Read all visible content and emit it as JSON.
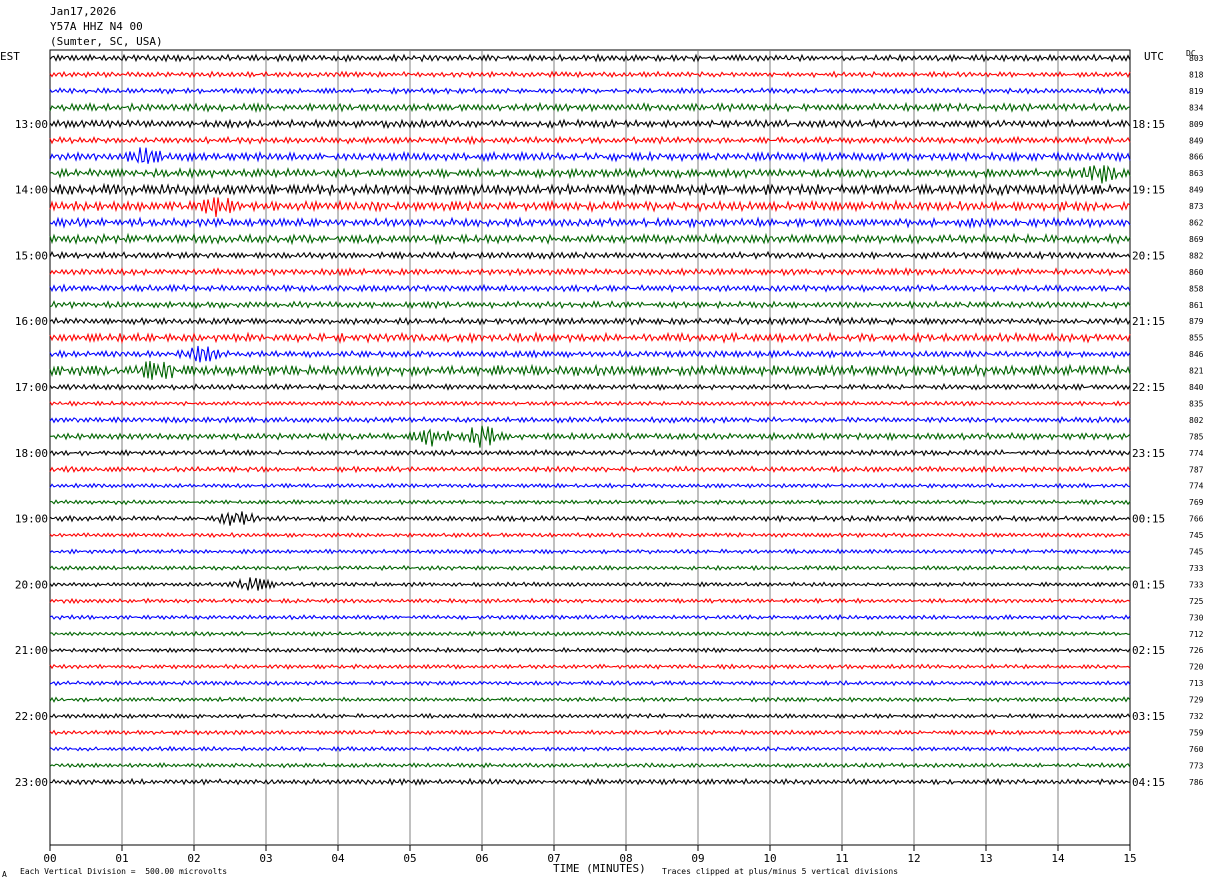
{
  "header": {
    "date": "Jan17,2026",
    "station": "Y57A HHZ N4 00",
    "location": "(Sumter, SC, USA)"
  },
  "left_axis_title": "EST",
  "right_axis_title": "UTC",
  "dc_label": "DC",
  "footer": {
    "scale_note": "Each Vertical Division =  500.00 microvolts",
    "clip_note": "Traces clipped at plus/minus 5 vertical divisions",
    "corner_mark": "A"
  },
  "colors": {
    "trace_cycle": [
      "#000000",
      "#ff0000",
      "#0000ff",
      "#006400"
    ],
    "grid": "#808080"
  },
  "chart_data": {
    "type": "line",
    "title": "Y57A HHZ N4 00",
    "xlabel": "TIME (MINUTES)",
    "xlim": [
      0,
      15
    ],
    "x_ticks": [
      "00",
      "01",
      "02",
      "03",
      "04",
      "05",
      "06",
      "07",
      "08",
      "09",
      "10",
      "11",
      "12",
      "13",
      "14",
      "15"
    ],
    "left_hour_labels": [
      "13:00",
      "14:00",
      "15:00",
      "16:00",
      "17:00",
      "18:00",
      "19:00",
      "20:00",
      "21:00",
      "22:00",
      "23:00"
    ],
    "right_hour_labels": [
      "18:15",
      "19:15",
      "20:15",
      "21:15",
      "22:15",
      "23:15",
      "00:15",
      "01:15",
      "02:15",
      "03:15",
      "04:15"
    ],
    "dc_offsets": [
      803,
      818,
      819,
      834,
      809,
      849,
      866,
      863,
      849,
      873,
      862,
      869,
      882,
      860,
      858,
      861,
      879,
      855,
      846,
      821,
      840,
      835,
      802,
      785,
      774,
      787,
      774,
      769,
      766,
      745,
      745,
      733,
      733,
      725,
      730,
      712,
      726,
      720,
      713,
      729,
      732,
      759,
      760,
      773,
      786
    ],
    "trace_minutes_per_line": 15,
    "trace_amplitude_level": [
      0.6,
      0.5,
      0.5,
      0.7,
      0.7,
      0.6,
      0.8,
      0.8,
      1.0,
      0.9,
      0.8,
      0.8,
      0.6,
      0.6,
      0.6,
      0.6,
      0.6,
      0.8,
      0.6,
      1.0,
      0.5,
      0.4,
      0.5,
      0.6,
      0.5,
      0.5,
      0.4,
      0.4,
      0.5,
      0.4,
      0.4,
      0.4,
      0.4,
      0.4,
      0.4,
      0.4,
      0.4,
      0.4,
      0.4,
      0.4,
      0.4,
      0.4,
      0.4,
      0.4,
      0.5
    ],
    "events": [
      {
        "line": 23,
        "minute": 5.3,
        "amplitude": 2.0
      },
      {
        "line": 23,
        "minute": 6.0,
        "amplitude": 2.6
      },
      {
        "line": 19,
        "minute": 1.5,
        "amplitude": 1.8
      },
      {
        "line": 18,
        "minute": 2.1,
        "amplitude": 1.6
      },
      {
        "line": 9,
        "minute": 2.3,
        "amplitude": 1.6
      },
      {
        "line": 28,
        "minute": 2.6,
        "amplitude": 1.5
      },
      {
        "line": 32,
        "minute": 2.8,
        "amplitude": 1.4
      },
      {
        "line": 6,
        "minute": 1.3,
        "amplitude": 1.5
      },
      {
        "line": 7,
        "minute": 14.6,
        "amplitude": 1.8
      }
    ]
  }
}
